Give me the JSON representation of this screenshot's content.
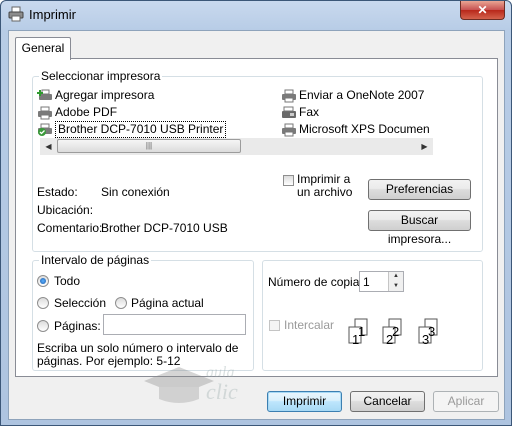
{
  "window": {
    "title": "Imprimir",
    "close_label": "✕"
  },
  "tabs": [
    {
      "label": "General"
    }
  ],
  "printer_group": {
    "legend": "Seleccionar impresora",
    "printers": [
      {
        "name": "Agregar impresora",
        "icon": "add-printer-icon"
      },
      {
        "name": "Adobe PDF",
        "icon": "printer-icon"
      },
      {
        "name": "Brother DCP-7010 USB Printer",
        "icon": "default-printer-icon",
        "selected": true
      },
      {
        "name": "Enviar a OneNote 2007",
        "icon": "printer-icon"
      },
      {
        "name": "Fax",
        "icon": "fax-icon"
      },
      {
        "name": "Microsoft XPS Documen",
        "icon": "printer-icon"
      }
    ],
    "status_label": "Estado:",
    "status_value": "Sin conexión",
    "location_label": "Ubicación:",
    "location_value": "",
    "comment_label": "Comentario:",
    "comment_value": "Brother DCP-7010 USB",
    "print_to_file_label": "Imprimir a un archivo",
    "print_to_file_line1": "Imprimir a",
    "print_to_file_line2": "un archivo",
    "preferences_button": "Preferencias",
    "find_printer_button": "Buscar impresora..."
  },
  "range_group": {
    "legend": "Intervalo de páginas",
    "all_label": "Todo",
    "selection_label": "Selección",
    "current_page_label": "Página actual",
    "pages_label": "Páginas:",
    "pages_value": "",
    "hint": "Escriba un solo número o intervalo de páginas. Por ejemplo: 5-12",
    "hint_line1": "Escriba un solo número o intervalo de",
    "hint_line2": "páginas. Por ejemplo: 5-12",
    "selected_option": "Todo"
  },
  "copies_group": {
    "copies_label": "Número de copias:",
    "copies_value": "1",
    "collate_label": "Intercalar",
    "collate_pages": [
      "1",
      "1",
      "2",
      "2",
      "3",
      "3"
    ]
  },
  "footer": {
    "print_button": "Imprimir",
    "cancel_button": "Cancelar",
    "apply_button": "Aplicar"
  },
  "watermark": {
    "text": "aula clic"
  },
  "colors": {
    "accent": "#3c7fb1",
    "title_bg": "#b7cce6",
    "close": "#c75050"
  }
}
